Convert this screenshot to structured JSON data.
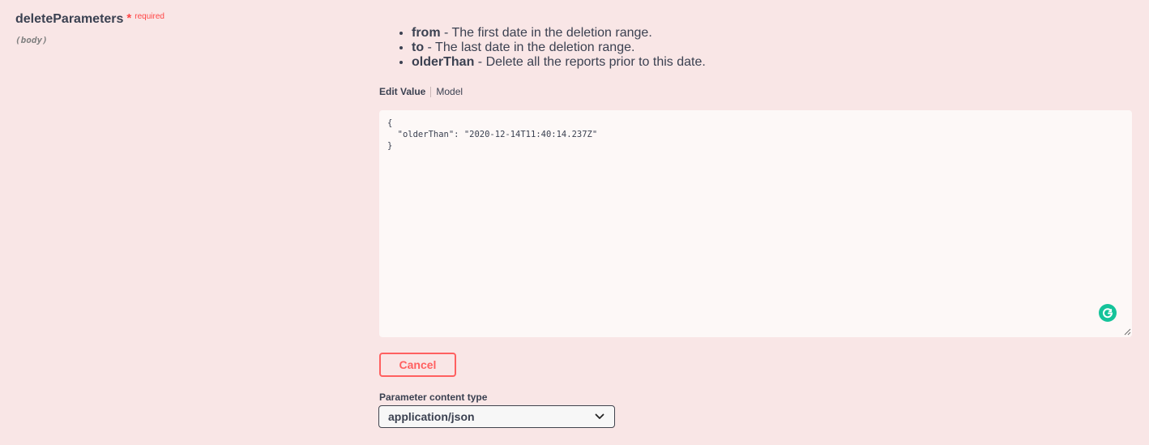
{
  "parameter": {
    "name": "deleteParameters",
    "required_star": "*",
    "required_label": "required",
    "location": "(body)"
  },
  "description": {
    "items": [
      {
        "key": "from",
        "text": " - The first date in the deletion range."
      },
      {
        "key": "to",
        "text": " - The last date in the deletion range."
      },
      {
        "key": "olderThan",
        "text": " - Delete all the reports prior to this date."
      }
    ]
  },
  "tabs": {
    "edit_value": "Edit Value",
    "model": "Model"
  },
  "editor": {
    "value": "{\n  \"olderThan\": \"2020-12-14T11:40:14.237Z\"\n}"
  },
  "buttons": {
    "cancel": "Cancel"
  },
  "content_type": {
    "label": "Parameter content type",
    "selected": "application/json"
  },
  "icons": {
    "grammarly": "grammarly-icon",
    "dropdown": "chevron-down-icon",
    "resize": "resize-handle-icon"
  },
  "colors": {
    "background": "#f9e6e6",
    "required": "#ff4545",
    "cancel": "#ff6060",
    "grammarly": "#15c39a"
  }
}
